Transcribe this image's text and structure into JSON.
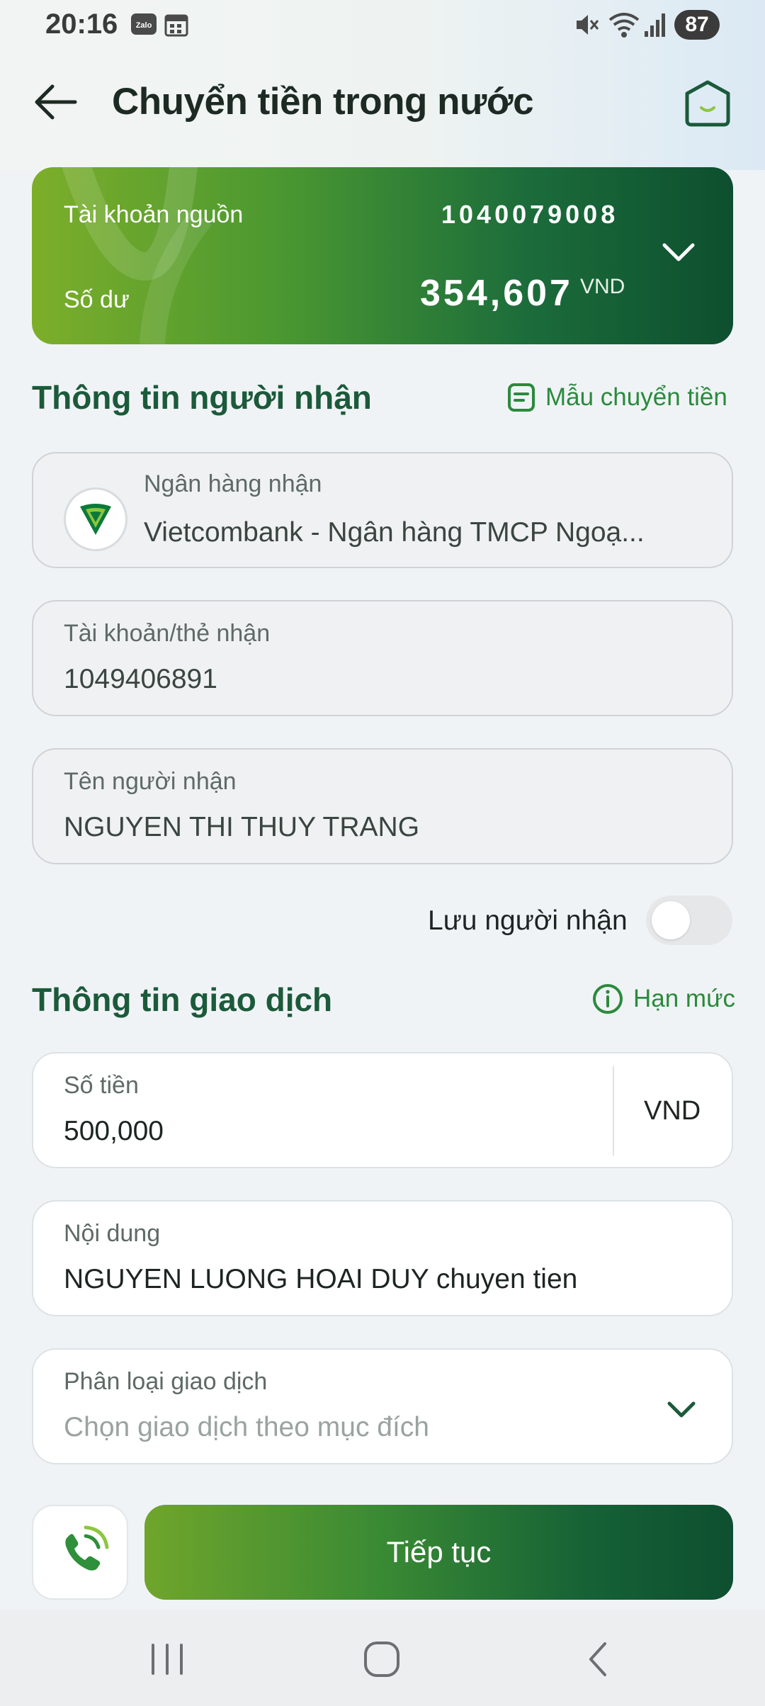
{
  "status_bar": {
    "time": "20:16",
    "battery": "87",
    "icons": [
      "zalo-icon",
      "calendar-icon",
      "mute-icon",
      "wifi-icon",
      "signal-icon"
    ]
  },
  "header": {
    "title": "Chuyển tiền trong nước",
    "back_icon": "arrow-left-icon",
    "home_icon": "home-icon"
  },
  "account_card": {
    "source_label": "Tài khoản nguồn",
    "source_number": "1040079008",
    "balance_label": "Số dư",
    "balance": "354,607",
    "currency": "VND"
  },
  "recipient_section": {
    "title": "Thông tin người nhận",
    "template_link": "Mẫu chuyển tiền",
    "bank_label": "Ngân hàng nhận",
    "bank_value": "Vietcombank - Ngân hàng TMCP Ngoạ...",
    "account_label": "Tài khoản/thẻ nhận",
    "account_value": "1049406891",
    "name_label": "Tên người nhận",
    "name_value": "NGUYEN THI THUY TRANG",
    "save_label": "Lưu người nhận",
    "save_enabled": false
  },
  "transaction_section": {
    "title": "Thông tin giao dịch",
    "limit_link": "Hạn mức",
    "amount_label": "Số tiền",
    "amount_value": "500,000",
    "amount_currency": "VND",
    "content_label": "Nội dung",
    "content_value": "NGUYEN LUONG HOAI DUY chuyen tien",
    "category_label": "Phân loại giao dịch",
    "category_placeholder": "Chọn giao dịch theo mục đích"
  },
  "actions": {
    "continue_label": "Tiếp tục",
    "call_icon": "phone-call-icon"
  },
  "colors": {
    "brand_green": "#1b5a3a",
    "link_green": "#2a8a3c",
    "card_start": "#7dae2a",
    "card_end": "#0d4f2f"
  }
}
